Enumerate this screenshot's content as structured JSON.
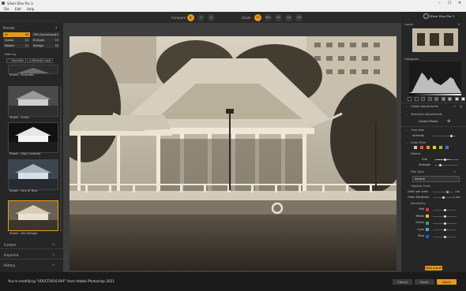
{
  "window": {
    "title": "Silver Efex Pro 3",
    "controls": [
      "–",
      "☐",
      "✕"
    ]
  },
  "menu": [
    "File",
    "Edit",
    "Help"
  ],
  "toolbar": {
    "compare_label": "Compare",
    "zoom_label": "Zoom",
    "zoom_options": [
      "FIT",
      "FILL",
      "1:1",
      "1:2",
      "1:3"
    ]
  },
  "left_panel": {
    "presets_title": "Presets",
    "categories": [
      [
        {
          "label": "All",
          "count": "68"
        },
        {
          "label": "25th Anniversary",
          "count": "15"
        }
      ],
      [
        {
          "label": "Classic",
          "count": "15"
        },
        {
          "label": "El Argue",
          "count": "15"
        }
      ],
      [
        {
          "label": "Modern",
          "count": "11"
        },
        {
          "label": "Vintage",
          "count": "22"
        }
      ]
    ],
    "filter_by": "Filter by",
    "favorites": "Favorites",
    "recently_used": "Recently used",
    "thumbs": [
      "Street - Dramatic",
      "Street - Gritty",
      "Street - High Contrast",
      "Street - Hint of Blue",
      "Street - Old Vintage"
    ],
    "custom": "Custom",
    "imported": "Imported",
    "history": "History"
  },
  "right_panel": {
    "app_title": "Silver Efex Pro 3",
    "loupe": "Loupe",
    "histogram": "Histogram",
    "sections": {
      "global": "Global Adjustments",
      "selective": "Selective Adjustments",
      "control_points": "Control Points",
      "overview": "Overview",
      "intensity": "Intensity",
      "color_filter": "Color Filter",
      "details": "Details",
      "hue": "Hue",
      "strength": "Strength",
      "film_type": "Film Type",
      "neutral": "Neutral",
      "original_grain": "Original Grain",
      "grain_per_pixel": "Grain per pixel",
      "grain_hardness": "Grain Hardness",
      "sensitivity": "Sensitivity",
      "save_preset": "Save preset"
    },
    "grain_values": {
      "per_pixel": "146",
      "hardness": "1,000"
    },
    "sensitivity": [
      {
        "name": "Red",
        "color": "#d43a2e"
      },
      {
        "name": "Yellow",
        "color": "#d9c22a"
      },
      {
        "name": "Green",
        "color": "#3aa845"
      },
      {
        "name": "Cyan",
        "color": "#2fb8c6"
      },
      {
        "name": "Blue",
        "color": "#3157c7"
      }
    ],
    "filter_swatches": [
      "#c9c9c9",
      "#e65a3a",
      "#e9953a",
      "#e8cf3a",
      "#7ac74a",
      "#3a76d8"
    ]
  },
  "bottom": {
    "status": "You're modifying \"VDSCF5616.RAF\" from Adobe Photoshop 2021",
    "cancel": "Cancel",
    "reset": "Reset",
    "apply": "Apply"
  },
  "colors": {
    "accent": "#e49a1b"
  }
}
